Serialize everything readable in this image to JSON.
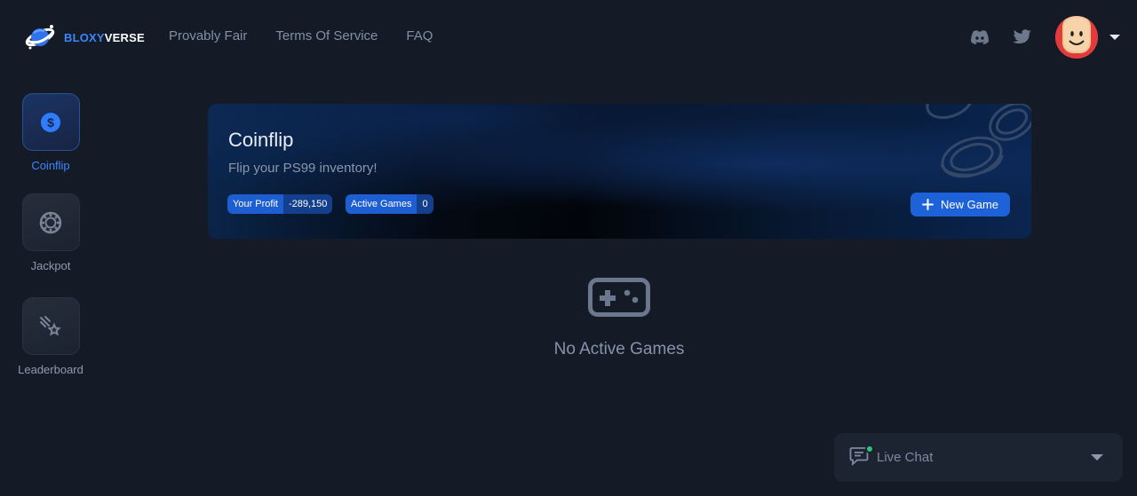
{
  "brand": {
    "part1": "BLOXY",
    "part2": "VERSE"
  },
  "nav": [
    "Provably Fair",
    "Terms Of Service",
    "FAQ"
  ],
  "header_icons": [
    "discord-icon",
    "twitter-icon"
  ],
  "sidebar": {
    "items": [
      {
        "label": "Coinflip",
        "icon": "dollar-coin-icon",
        "active": true
      },
      {
        "label": "Jackpot",
        "icon": "chip-icon",
        "active": false
      },
      {
        "label": "Leaderboard",
        "icon": "shooting-star-icon",
        "active": false
      }
    ]
  },
  "banner": {
    "title": "Coinflip",
    "subtitle": "Flip your PS99 inventory!",
    "stats": [
      {
        "label": "Your Profit",
        "value": "-289,150"
      },
      {
        "label": "Active Games",
        "value": "0"
      }
    ],
    "new_game_label": "New Game"
  },
  "empty": {
    "text": "No Active Games",
    "icon": "gamepad-icon"
  },
  "chat": {
    "label": "Live Chat",
    "online_color": "#29c76f"
  },
  "colors": {
    "accent": "#1e62da",
    "background": "#141a26",
    "brand_blue": "#3b86ff"
  }
}
